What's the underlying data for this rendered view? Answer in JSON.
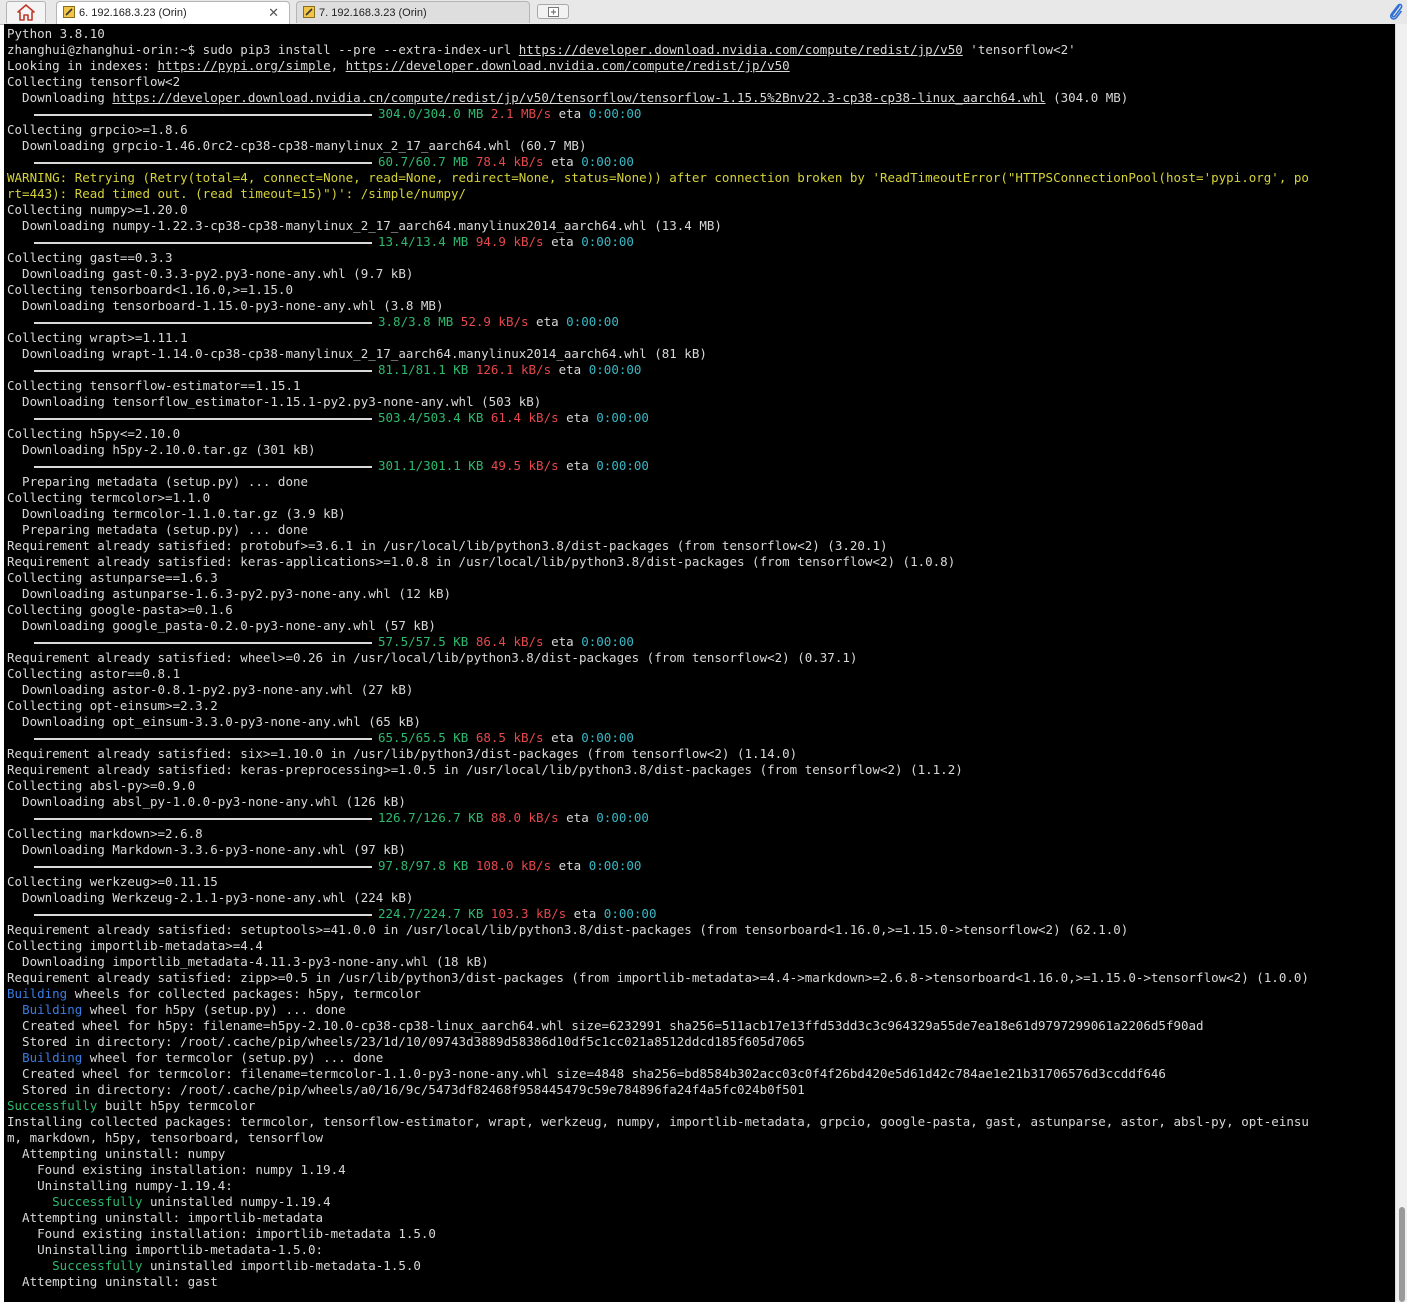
{
  "tabs": [
    {
      "label": "6. 192.168.3.23 (Orin)",
      "active": true
    },
    {
      "label": "7. 192.168.3.23 (Orin)",
      "active": false
    }
  ],
  "colors": {
    "green": "#2fb96f",
    "red": "#e5484d",
    "cyan": "#3ab8c5",
    "yellow": "#d5d23a",
    "blue": "#3a7de3",
    "text": "#d9d9d9",
    "background": "#000000"
  },
  "icons": {
    "home": "home-icon",
    "tab": "terminal-icon",
    "newtab": "new-tab-icon",
    "attach": "paperclip-icon"
  },
  "terminal": {
    "lines": [
      [
        {
          "t": "Python 3.8.10"
        }
      ],
      [
        {
          "t": "zhanghui@zhanghui-orin:~$ sudo pip3 install --pre --extra-index-url "
        },
        {
          "t": "https://developer.download.nvidia.com/compute/redist/jp/v50",
          "u": 1
        },
        {
          "t": " 'tensorflow<2'"
        }
      ],
      [
        {
          "t": "Looking in indexes: "
        },
        {
          "t": "https://pypi.org/simple",
          "u": 1
        },
        {
          "t": ", "
        },
        {
          "t": "https://developer.download.nvidia.com/compute/redist/jp/v50",
          "u": 1
        }
      ],
      [
        {
          "t": "Collecting tensorflow<2"
        }
      ],
      [
        {
          "t": "  Downloading "
        },
        {
          "t": "https://developer.download.nvidia.cn/compute/redist/jp/v50/tensorflow/tensorflow-1.15.5%2Bnv22.3-cp38-cp38-linux_aarch64.whl",
          "u": 1
        },
        {
          "t": " (304.0 MB)"
        }
      ],
      [
        {
          "bar": 1
        },
        {
          "t": "304.0/304.0 MB",
          "c": "g"
        },
        {
          "t": " "
        },
        {
          "t": "2.1 MB/s",
          "c": "r"
        },
        {
          "t": " eta "
        },
        {
          "t": "0:00:00",
          "c": "c"
        }
      ],
      [
        {
          "t": "Collecting grpcio>=1.8.6"
        }
      ],
      [
        {
          "t": "  Downloading grpcio-1.46.0rc2-cp38-cp38-manylinux_2_17_aarch64.whl (60.7 MB)"
        }
      ],
      [
        {
          "bar": 1
        },
        {
          "t": "60.7/60.7 MB",
          "c": "g"
        },
        {
          "t": " "
        },
        {
          "t": "78.4 kB/s",
          "c": "r"
        },
        {
          "t": " eta "
        },
        {
          "t": "0:00:00",
          "c": "c"
        }
      ],
      [
        {
          "t": "WARNING: Retrying (Retry(total=4, connect=None, read=None, redirect=None, status=None)) after connection broken by 'ReadTimeoutError(\"HTTPSConnectionPool(host='pypi.org', po",
          "c": "y"
        }
      ],
      [
        {
          "t": "rt=443): Read timed out. (read timeout=15)\")': /simple/numpy/",
          "c": "y"
        }
      ],
      [
        {
          "t": "Collecting numpy>=1.20.0"
        }
      ],
      [
        {
          "t": "  Downloading numpy-1.22.3-cp38-cp38-manylinux_2_17_aarch64.manylinux2014_aarch64.whl (13.4 MB)"
        }
      ],
      [
        {
          "bar": 1
        },
        {
          "t": "13.4/13.4 MB",
          "c": "g"
        },
        {
          "t": " "
        },
        {
          "t": "94.9 kB/s",
          "c": "r"
        },
        {
          "t": " eta "
        },
        {
          "t": "0:00:00",
          "c": "c"
        }
      ],
      [
        {
          "t": "Collecting gast==0.3.3"
        }
      ],
      [
        {
          "t": "  Downloading gast-0.3.3-py2.py3-none-any.whl (9.7 kB)"
        }
      ],
      [
        {
          "t": "Collecting tensorboard<1.16.0,>=1.15.0"
        }
      ],
      [
        {
          "t": "  Downloading tensorboard-1.15.0-py3-none-any.whl (3.8 MB)"
        }
      ],
      [
        {
          "bar": 1
        },
        {
          "t": "3.8/3.8 MB",
          "c": "g"
        },
        {
          "t": " "
        },
        {
          "t": "52.9 kB/s",
          "c": "r"
        },
        {
          "t": " eta "
        },
        {
          "t": "0:00:00",
          "c": "c"
        }
      ],
      [
        {
          "t": "Collecting wrapt>=1.11.1"
        }
      ],
      [
        {
          "t": "  Downloading wrapt-1.14.0-cp38-cp38-manylinux_2_17_aarch64.manylinux2014_aarch64.whl (81 kB)"
        }
      ],
      [
        {
          "bar": 1
        },
        {
          "t": "81.1/81.1 KB",
          "c": "g"
        },
        {
          "t": " "
        },
        {
          "t": "126.1 kB/s",
          "c": "r"
        },
        {
          "t": " eta "
        },
        {
          "t": "0:00:00",
          "c": "c"
        }
      ],
      [
        {
          "t": "Collecting tensorflow-estimator==1.15.1"
        }
      ],
      [
        {
          "t": "  Downloading tensorflow_estimator-1.15.1-py2.py3-none-any.whl (503 kB)"
        }
      ],
      [
        {
          "bar": 1
        },
        {
          "t": "503.4/503.4 KB",
          "c": "g"
        },
        {
          "t": " "
        },
        {
          "t": "61.4 kB/s",
          "c": "r"
        },
        {
          "t": " eta "
        },
        {
          "t": "0:00:00",
          "c": "c"
        }
      ],
      [
        {
          "t": "Collecting h5py<=2.10.0"
        }
      ],
      [
        {
          "t": "  Downloading h5py-2.10.0.tar.gz (301 kB)"
        }
      ],
      [
        {
          "bar": 1
        },
        {
          "t": "301.1/301.1 KB",
          "c": "g"
        },
        {
          "t": " "
        },
        {
          "t": "49.5 kB/s",
          "c": "r"
        },
        {
          "t": " eta "
        },
        {
          "t": "0:00:00",
          "c": "c"
        }
      ],
      [
        {
          "t": "  Preparing metadata (setup.py) ... done"
        }
      ],
      [
        {
          "t": "Collecting termcolor>=1.1.0"
        }
      ],
      [
        {
          "t": "  Downloading termcolor-1.1.0.tar.gz (3.9 kB)"
        }
      ],
      [
        {
          "t": "  Preparing metadata (setup.py) ... done"
        }
      ],
      [
        {
          "t": "Requirement already satisfied: protobuf>=3.6.1 in /usr/local/lib/python3.8/dist-packages (from tensorflow<2) (3.20.1)"
        }
      ],
      [
        {
          "t": "Requirement already satisfied: keras-applications>=1.0.8 in /usr/local/lib/python3.8/dist-packages (from tensorflow<2) (1.0.8)"
        }
      ],
      [
        {
          "t": "Collecting astunparse==1.6.3"
        }
      ],
      [
        {
          "t": "  Downloading astunparse-1.6.3-py2.py3-none-any.whl (12 kB)"
        }
      ],
      [
        {
          "t": "Collecting google-pasta>=0.1.6"
        }
      ],
      [
        {
          "t": "  Downloading google_pasta-0.2.0-py3-none-any.whl (57 kB)"
        }
      ],
      [
        {
          "bar": 1
        },
        {
          "t": "57.5/57.5 KB",
          "c": "g"
        },
        {
          "t": " "
        },
        {
          "t": "86.4 kB/s",
          "c": "r"
        },
        {
          "t": " eta "
        },
        {
          "t": "0:00:00",
          "c": "c"
        }
      ],
      [
        {
          "t": "Requirement already satisfied: wheel>=0.26 in /usr/local/lib/python3.8/dist-packages (from tensorflow<2) (0.37.1)"
        }
      ],
      [
        {
          "t": "Collecting astor==0.8.1"
        }
      ],
      [
        {
          "t": "  Downloading astor-0.8.1-py2.py3-none-any.whl (27 kB)"
        }
      ],
      [
        {
          "t": "Collecting opt-einsum>=2.3.2"
        }
      ],
      [
        {
          "t": "  Downloading opt_einsum-3.3.0-py3-none-any.whl (65 kB)"
        }
      ],
      [
        {
          "bar": 1
        },
        {
          "t": "65.5/65.5 KB",
          "c": "g"
        },
        {
          "t": " "
        },
        {
          "t": "68.5 kB/s",
          "c": "r"
        },
        {
          "t": " eta "
        },
        {
          "t": "0:00:00",
          "c": "c"
        }
      ],
      [
        {
          "t": "Requirement already satisfied: six>=1.10.0 in /usr/lib/python3/dist-packages (from tensorflow<2) (1.14.0)"
        }
      ],
      [
        {
          "t": "Requirement already satisfied: keras-preprocessing>=1.0.5 in /usr/local/lib/python3.8/dist-packages (from tensorflow<2) (1.1.2)"
        }
      ],
      [
        {
          "t": "Collecting absl-py>=0.9.0"
        }
      ],
      [
        {
          "t": "  Downloading absl_py-1.0.0-py3-none-any.whl (126 kB)"
        }
      ],
      [
        {
          "bar": 1
        },
        {
          "t": "126.7/126.7 KB",
          "c": "g"
        },
        {
          "t": " "
        },
        {
          "t": "88.0 kB/s",
          "c": "r"
        },
        {
          "t": " eta "
        },
        {
          "t": "0:00:00",
          "c": "c"
        }
      ],
      [
        {
          "t": "Collecting markdown>=2.6.8"
        }
      ],
      [
        {
          "t": "  Downloading Markdown-3.3.6-py3-none-any.whl (97 kB)"
        }
      ],
      [
        {
          "bar": 1
        },
        {
          "t": "97.8/97.8 KB",
          "c": "g"
        },
        {
          "t": " "
        },
        {
          "t": "108.0 kB/s",
          "c": "r"
        },
        {
          "t": " eta "
        },
        {
          "t": "0:00:00",
          "c": "c"
        }
      ],
      [
        {
          "t": "Collecting werkzeug>=0.11.15"
        }
      ],
      [
        {
          "t": "  Downloading Werkzeug-2.1.1-py3-none-any.whl (224 kB)"
        }
      ],
      [
        {
          "bar": 1
        },
        {
          "t": "224.7/224.7 KB",
          "c": "g"
        },
        {
          "t": " "
        },
        {
          "t": "103.3 kB/s",
          "c": "r"
        },
        {
          "t": " eta "
        },
        {
          "t": "0:00:00",
          "c": "c"
        }
      ],
      [
        {
          "t": "Requirement already satisfied: setuptools>=41.0.0 in /usr/local/lib/python3.8/dist-packages (from tensorboard<1.16.0,>=1.15.0->tensorflow<2) (62.1.0)"
        }
      ],
      [
        {
          "t": "Collecting importlib-metadata>=4.4"
        }
      ],
      [
        {
          "t": "  Downloading importlib_metadata-4.11.3-py3-none-any.whl (18 kB)"
        }
      ],
      [
        {
          "t": "Requirement already satisfied: zipp>=0.5 in /usr/lib/python3/dist-packages (from importlib-metadata>=4.4->markdown>=2.6.8->tensorboard<1.16.0,>=1.15.0->tensorflow<2) (1.0.0)"
        }
      ],
      [
        {
          "t": "Building",
          "c": "b"
        },
        {
          "t": " wheels for collected packages: h5py, termcolor"
        }
      ],
      [
        {
          "t": "  "
        },
        {
          "t": "Building",
          "c": "b"
        },
        {
          "t": " wheel for h5py (setup.py) ... done"
        }
      ],
      [
        {
          "t": "  Created wheel for h5py: filename=h5py-2.10.0-cp38-cp38-linux_aarch64.whl size=6232991 sha256=511acb17e13ffd53dd3c3c964329a55de7ea18e61d9797299061a2206d5f90ad"
        }
      ],
      [
        {
          "t": "  Stored in directory: /root/.cache/pip/wheels/23/1d/10/09743d3889d58386d10df5c1cc021a8512ddcd185f605d7065"
        }
      ],
      [
        {
          "t": "  "
        },
        {
          "t": "Building",
          "c": "b"
        },
        {
          "t": " wheel for termcolor (setup.py) ... done"
        }
      ],
      [
        {
          "t": "  Created wheel for termcolor: filename=termcolor-1.1.0-py3-none-any.whl size=4848 sha256=bd8584b302acc03c0f4f26bd420e5d61d42c784ae1e21b31706576d3ccddf646"
        }
      ],
      [
        {
          "t": "  Stored in directory: /root/.cache/pip/wheels/a0/16/9c/5473df82468f958445479c59e784896fa24f4a5fc024b0f501"
        }
      ],
      [
        {
          "t": "Successfully",
          "c": "g"
        },
        {
          "t": " built h5py termcolor"
        }
      ],
      [
        {
          "t": "Installing collected packages: termcolor, tensorflow-estimator, wrapt, werkzeug, numpy, importlib-metadata, grpcio, google-pasta, gast, astunparse, astor, absl-py, opt-einsu"
        }
      ],
      [
        {
          "t": "m, markdown, h5py, tensorboard, tensorflow"
        }
      ],
      [
        {
          "t": "  Attempting uninstall: numpy"
        }
      ],
      [
        {
          "t": "    Found existing installation: numpy 1.19.4"
        }
      ],
      [
        {
          "t": "    Uninstalling numpy-1.19.4:"
        }
      ],
      [
        {
          "t": "      "
        },
        {
          "t": "Successfully",
          "c": "g"
        },
        {
          "t": " uninstalled numpy-1.19.4"
        }
      ],
      [
        {
          "t": "  Attempting uninstall: importlib-metadata"
        }
      ],
      [
        {
          "t": "    Found existing installation: importlib-metadata 1.5.0"
        }
      ],
      [
        {
          "t": "    Uninstalling importlib-metadata-1.5.0:"
        }
      ],
      [
        {
          "t": "      "
        },
        {
          "t": "Successfully",
          "c": "g"
        },
        {
          "t": " uninstalled importlib-metadata-1.5.0"
        }
      ],
      [
        {
          "t": "  Attempting uninstall: gast"
        }
      ]
    ]
  }
}
